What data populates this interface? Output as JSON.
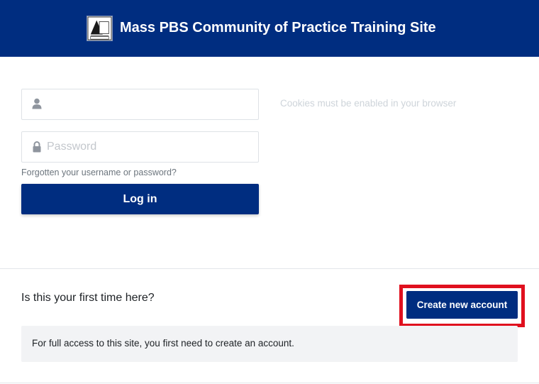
{
  "header": {
    "title": "Mass PBS Community of Practice Training Site",
    "logo_icon": "pbs-logo-icon",
    "background_color": "#002d80"
  },
  "login": {
    "username_value": "",
    "username_icon": "user-icon",
    "password_placeholder": "Password",
    "password_icon": "lock-icon",
    "forgot_label": "Forgotten your username or password?",
    "login_label": "Log in",
    "cookies_note": "Cookies must be enabled in your browser"
  },
  "signup": {
    "prompt": "Is this your first time here?",
    "create_label": "Create new account",
    "highlight_color": "#e0101e",
    "access_text": "For full access to this site, you first need to create an account."
  }
}
